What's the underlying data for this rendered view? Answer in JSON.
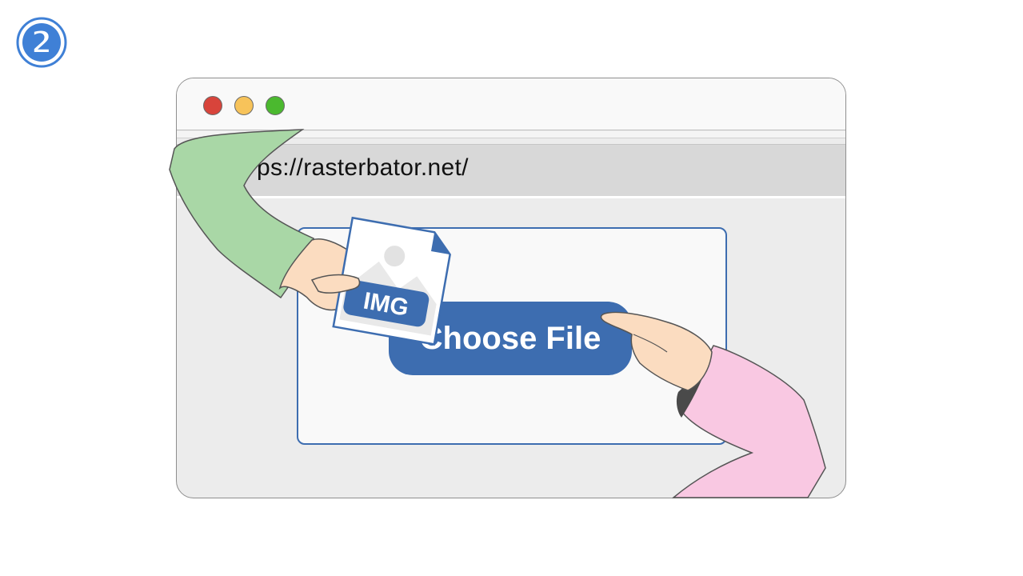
{
  "step": {
    "number": "2",
    "icon": "circled-number-icon",
    "color": "#3f80d6"
  },
  "browser": {
    "window_controls": [
      {
        "name": "close",
        "color": "#d8443b"
      },
      {
        "name": "minimize",
        "color": "#f7c35a"
      },
      {
        "name": "maximize",
        "color": "#4bb92f"
      }
    ],
    "address_bar": {
      "url_text": "ps://rasterbator.net/"
    }
  },
  "upload": {
    "button_label": "Choose File",
    "accent_color": "#3d6db0"
  },
  "file": {
    "tag_label": "IMG",
    "icon": "image-file-icon"
  },
  "hands": {
    "left": {
      "icon": "hand-holding-file-icon",
      "sleeve_color": "#a9d7a6"
    },
    "right": {
      "icon": "hand-pointing-icon",
      "sleeve_color": "#f9c8e2"
    }
  }
}
